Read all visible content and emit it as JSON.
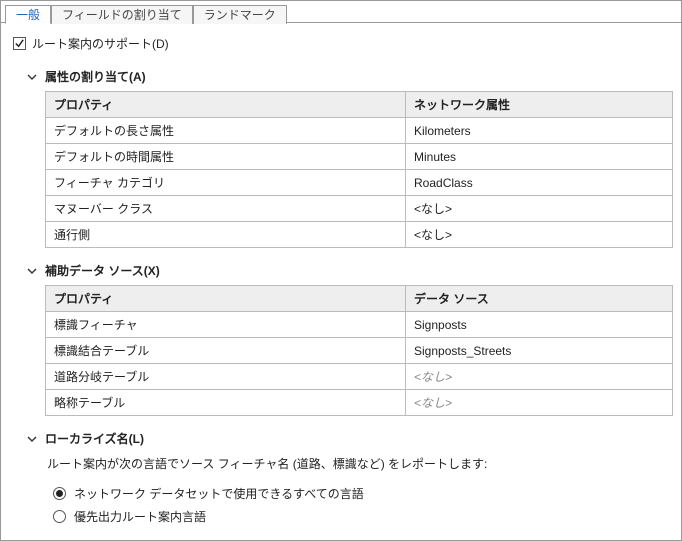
{
  "tabs": {
    "general": "一般",
    "field_mapping": "フィールドの割り当て",
    "landmarks": "ランドマーク"
  },
  "support_checkbox": {
    "label": "ルート案内のサポート(D)"
  },
  "sections": {
    "attributes": {
      "title": "属性の割り当て(A)",
      "headers": {
        "property": "プロパティ",
        "attribute": "ネットワーク属性"
      },
      "rows": [
        {
          "prop": "デフォルトの長さ属性",
          "value": "Kilometers",
          "disabled": false
        },
        {
          "prop": "デフォルトの時間属性",
          "value": "Minutes",
          "disabled": false
        },
        {
          "prop": "フィーチャ カテゴリ",
          "value": "RoadClass",
          "disabled": false
        },
        {
          "prop": "マヌーバー クラス",
          "value": "<なし>",
          "disabled": false
        },
        {
          "prop": "通行側",
          "value": "<なし>",
          "disabled": false
        }
      ]
    },
    "auxiliary": {
      "title": "補助データ ソース(X)",
      "headers": {
        "property": "プロパティ",
        "source": "データ ソース"
      },
      "rows": [
        {
          "prop": "標識フィーチャ",
          "value": "Signposts",
          "disabled": false
        },
        {
          "prop": "標識結合テーブル",
          "value": "Signposts_Streets",
          "disabled": false
        },
        {
          "prop": "道路分岐テーブル",
          "value": "<なし>",
          "disabled": true
        },
        {
          "prop": "略称テーブル",
          "value": "<なし>",
          "disabled": true
        }
      ]
    },
    "localization": {
      "title": "ローカライズ名(L)",
      "description": "ルート案内が次の言語でソース フィーチャ名 (道路、標識など) をレポートします:",
      "option_all": "ネットワーク データセットで使用できるすべての言語",
      "option_preferred": "優先出力ルート案内言語"
    }
  }
}
